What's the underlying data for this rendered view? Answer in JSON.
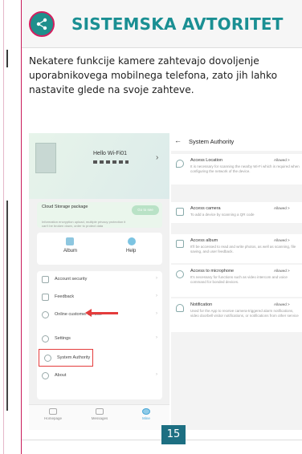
{
  "header": {
    "title": "SISTEMSKA AVTORITET",
    "icon": "share-icon"
  },
  "intro_text": "Nekatere funkcije kamere zahtevajo dovoljenje uporabnikovega mobilnega telefona, zato jih lahko nastavite glede na svoje zahteve.",
  "left_screen": {
    "device_title": "Hello Wi-Fi01",
    "cloud_title": "Cloud Storage package",
    "cloud_desc": "Information encryption upload, multiple privacy protection it can't be broken down, order to protect data",
    "cloud_button": "Go to see",
    "quick_album": "Album",
    "quick_help": "Help",
    "menu": [
      "Account security",
      "Feedback",
      "Online customer service",
      "Settings",
      "System Authority",
      "About"
    ],
    "tabs": [
      "Homepage",
      "Messages",
      "Mine"
    ]
  },
  "right_screen": {
    "title": "System Authority",
    "items": [
      {
        "name": "Access Location",
        "status": "Allowed >",
        "desc": "It is necessary for scanning the nearby Wi-Fi which is required when configuring the network of the device."
      },
      {
        "name": "Access camera",
        "status": "Allowed >",
        "desc": "To add a device by scanning a QR code"
      },
      {
        "name": "Access album",
        "status": "Allowed >",
        "desc": "It'll be accessed to read and write photos, as well as scanning, file saving, and user feedback."
      },
      {
        "name": "Access to microphone",
        "status": "Allowed >",
        "desc": "It's necessary for functions such as video intercom and voice command for bonded devices."
      },
      {
        "name": "Notification",
        "status": "Allowed >",
        "desc": "Used for the App to receive camera-triggered alarm notifications, video doorbell visitor notifications, or notifications from other service"
      }
    ]
  },
  "page_number": "15",
  "colors": {
    "title": "#1a8f93",
    "badge": "#1f8f8c",
    "border": "#c91a5a",
    "highlight": "#e43c3c",
    "page_number_bg": "#1d6f82"
  }
}
